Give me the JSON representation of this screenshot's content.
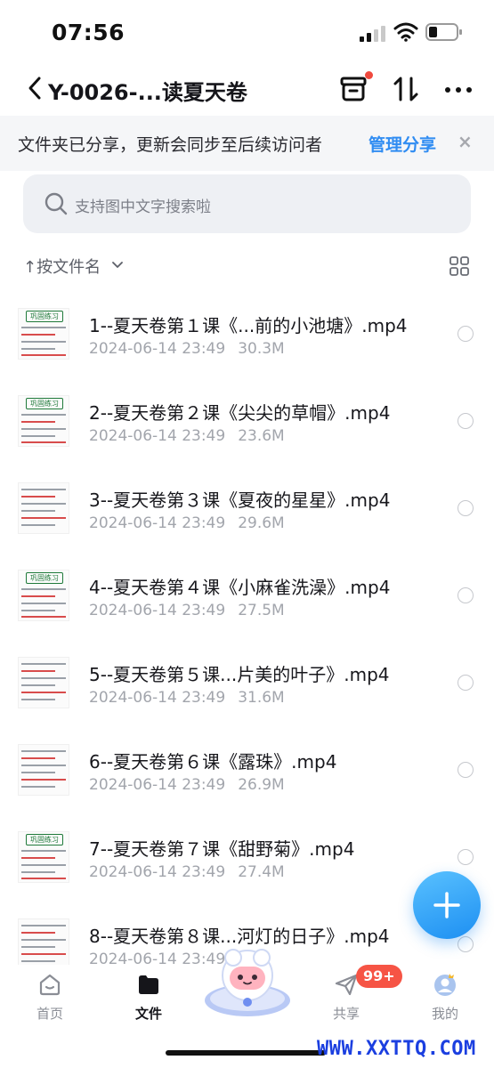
{
  "status_bar": {
    "time": "07:56"
  },
  "nav": {
    "title": "Y-0026-...读夏天卷"
  },
  "share_banner": {
    "message": "文件夹已分享，更新会同步至后续访问者",
    "action": "管理分享",
    "close": "×"
  },
  "search": {
    "placeholder": "支持图中文字搜索啦"
  },
  "sort": {
    "label": "↑按文件名"
  },
  "files": [
    {
      "name": "1--夏天卷第１课《...前的小池塘》.mp4",
      "date": "2024-06-14 23:49",
      "size": "30.3M",
      "thumb_tag": "巩固练习"
    },
    {
      "name": "2--夏天卷第２课《尖尖的草帽》.mp4",
      "date": "2024-06-14 23:49",
      "size": "23.6M",
      "thumb_tag": "巩固练习"
    },
    {
      "name": "3--夏天卷第３课《夏夜的星星》.mp4",
      "date": "2024-06-14 23:49",
      "size": "29.6M",
      "thumb_tag": ""
    },
    {
      "name": "4--夏天卷第４课《小麻雀洗澡》.mp4",
      "date": "2024-06-14 23:49",
      "size": "27.5M",
      "thumb_tag": "巩固练习"
    },
    {
      "name": "5--夏天卷第５课...片美的叶子》.mp4",
      "date": "2024-06-14 23:49",
      "size": "31.6M",
      "thumb_tag": ""
    },
    {
      "name": "6--夏天卷第６课《露珠》.mp4",
      "date": "2024-06-14 23:49",
      "size": "26.9M",
      "thumb_tag": ""
    },
    {
      "name": "7--夏天卷第７课《甜野菊》.mp4",
      "date": "2024-06-14 23:49",
      "size": "27.4M",
      "thumb_tag": "巩固练习"
    },
    {
      "name": "8--夏天卷第８课...河灯的日子》.mp4",
      "date": "2024-06-14 23:49",
      "size": "",
      "thumb_tag": ""
    }
  ],
  "tabs": [
    {
      "label": "首页",
      "icon": "home-icon"
    },
    {
      "label": "文件",
      "icon": "folder-icon"
    },
    {
      "label": "共享",
      "icon": "share-plane-icon",
      "badge": "99+"
    },
    {
      "label": "我的",
      "icon": "avatar-icon"
    }
  ],
  "watermark": "WWW.XXTTQ.COM",
  "colors": {
    "accent": "#2f8cf2",
    "badge": "#f65445",
    "fab": "#1d8ff2"
  }
}
